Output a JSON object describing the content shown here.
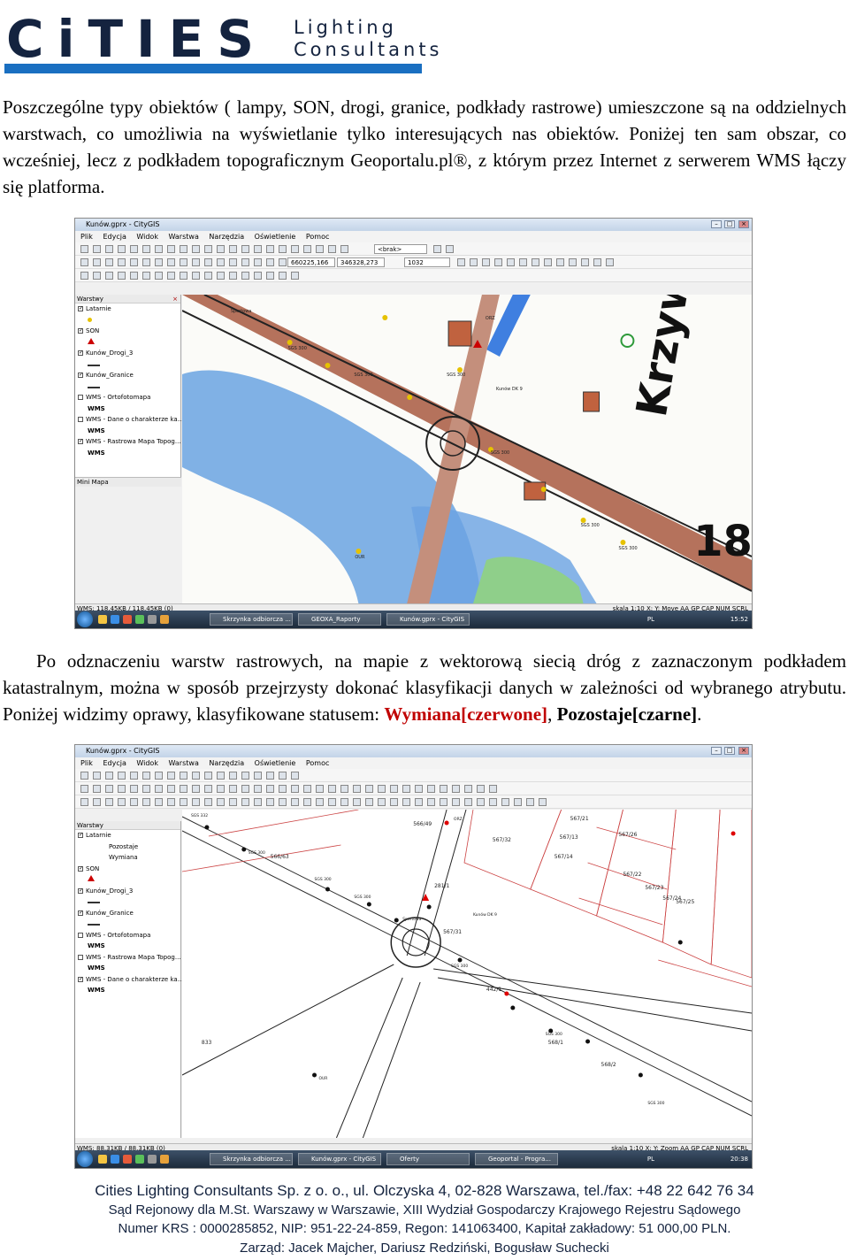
{
  "header": {
    "logo_main": "CiTIES",
    "logo_line1": "Lighting",
    "logo_line2": "Consultants",
    "brand_color": "#14233f",
    "accent_color": "#1a6fc1"
  },
  "paragraph1": "Poszczególne typy obiektów ( lampy, SON, drogi, granice, podkłady rastrowe) umieszczone są na oddzielnych warstwach, co umożliwia na wyświetlanie tylko interesujących nas obiektów. Poniżej ten sam obszar, co wcześniej, lecz z podkładem topograficznym Geoportalu.pl®, z którym przez Internet z serwerem WMS łączy się platforma.",
  "paragraph2": {
    "text": "Po odznaczeniu warstw rastrowych, na mapie z wektorową siecią dróg z zaznaczonym podkładem katastralnym, można w sposób przejrzysty dokonać klasyfikacji danych w zależności od wybranego atrybutu. Poniżej widzimy oprawy, klasyfikowane statusem: ",
    "red_part": "Wymiana[czerwone]",
    "separator": ", ",
    "bold_part": "Pozostaje[czarne]",
    "end": "."
  },
  "screenshot1": {
    "title": "Kunów.gprx - CityGIS",
    "menu": [
      "Plik",
      "Edycja",
      "Widok",
      "Warstwa",
      "Narzędzia",
      "Oświetlenie",
      "Pomoc"
    ],
    "coord_x": "660225,166",
    "coord_y": "346328,273",
    "scale_value": "1032",
    "brak": "<brak>",
    "layers_header": "Warstwy",
    "layers": [
      {
        "label": "Latarnie",
        "checked": "✓"
      },
      {
        "label": "SON",
        "checked": "✓"
      },
      {
        "label": "Kunów_Drogi_3",
        "checked": "✓"
      },
      {
        "label": "Kunów_Granice",
        "checked": "✓"
      },
      {
        "label": "WMS - Ortofotomapa",
        "checked": ""
      },
      {
        "label": "WMS - Dane o charakterze ka...",
        "checked": ""
      },
      {
        "label": "WMS - Rastrowa Mapa Topog...",
        "checked": "✓"
      }
    ],
    "wms_label": "WMS",
    "minimap": "Mini Mapa",
    "status_left": "WMS: 118.45KB / 118.45KB (0)",
    "status_right": "skala 1:10  X:  Y:  Move  AA  GP  CAP  NUM  SCRL",
    "tasks": [
      "Skrzynka odbiorcza ...",
      "GEOXA_Raporty",
      "Kunów.gprx - CityGIS"
    ],
    "lang": "PL",
    "clock": "15:52",
    "map_labels": [
      "Krzywa",
      "18",
      "Kunów DK 9",
      "SGS 300",
      "SGS 300",
      "SGS 300",
      "SGS 300",
      "OUR",
      "SGS 300",
      "SGS 300",
      "Sportowa",
      "ORZ"
    ]
  },
  "screenshot2": {
    "title": "Kunów.gprx - CityGIS",
    "menu": [
      "Plik",
      "Edycja",
      "Widok",
      "Warstwa",
      "Narzędzia",
      "Oświetlenie",
      "Pomoc"
    ],
    "scale_value": "1000",
    "layers_header": "Warstwy",
    "layers": [
      {
        "label": "Latarnie",
        "checked": "✓"
      },
      {
        "label": "Pozostaje",
        "checked": ""
      },
      {
        "label": "Wymiana",
        "checked": ""
      },
      {
        "label": "SON",
        "checked": "✓"
      },
      {
        "label": "Kunów_Drogi_3",
        "checked": "✓"
      },
      {
        "label": "Kunów_Granice",
        "checked": "✓"
      },
      {
        "label": "WMS - Ortofotomapa",
        "checked": ""
      },
      {
        "label": "WMS - Rastrowa Mapa Topog...",
        "checked": ""
      },
      {
        "label": "WMS - Dane o charakterze ka...",
        "checked": "✓"
      }
    ],
    "wms_label": "WMS",
    "status_left": "WMS: 88.31KB / 88.31KB (0)",
    "status_right": "skala 1:10  X:  Y:  Zoom  AA  GP  CAP  NUM  SCRL",
    "tasks": [
      "Skrzynka odbiorcza ...",
      "Kunów.gprx - CityGIS",
      "Oferty",
      "Geoportal - Progra..."
    ],
    "lang": "PL",
    "clock": "20:38",
    "parcels": [
      "566/49",
      "567/21",
      "567/32",
      "567/13",
      "567/26",
      "567/14",
      "567/22",
      "567/23",
      "567/24",
      "567/25",
      "566/63",
      "281/1",
      "567/31",
      "442/1",
      "568/1",
      "568/2",
      "833"
    ],
    "map_labels": [
      "Kunów DK 9",
      "ORZ",
      "SGS 300",
      "SGS 300",
      "SGS 300",
      "SGS 300",
      "SGS 300",
      "SGS 300",
      "OUR",
      "Sportowa",
      "SGS 332"
    ]
  },
  "footer": {
    "line1": "Cities Lighting Consultants Sp. z o. o., ul. Olczyska 4, 02-828 Warszawa, tel./fax: +48 22 642 76 34",
    "line2": "Sąd Rejonowy dla M.St. Warszawy w Warszawie, XIII Wydział Gospodarczy Krajowego Rejestru Sądowego",
    "line3": "Numer KRS : 0000285852, NIP: 951-22-24-859, Regon: 141063400, Kapitał zakładowy: 51 000,00 PLN.",
    "line4": "Zarząd: Jacek Majcher, Dariusz Redziński, Bogusław Suchecki"
  }
}
